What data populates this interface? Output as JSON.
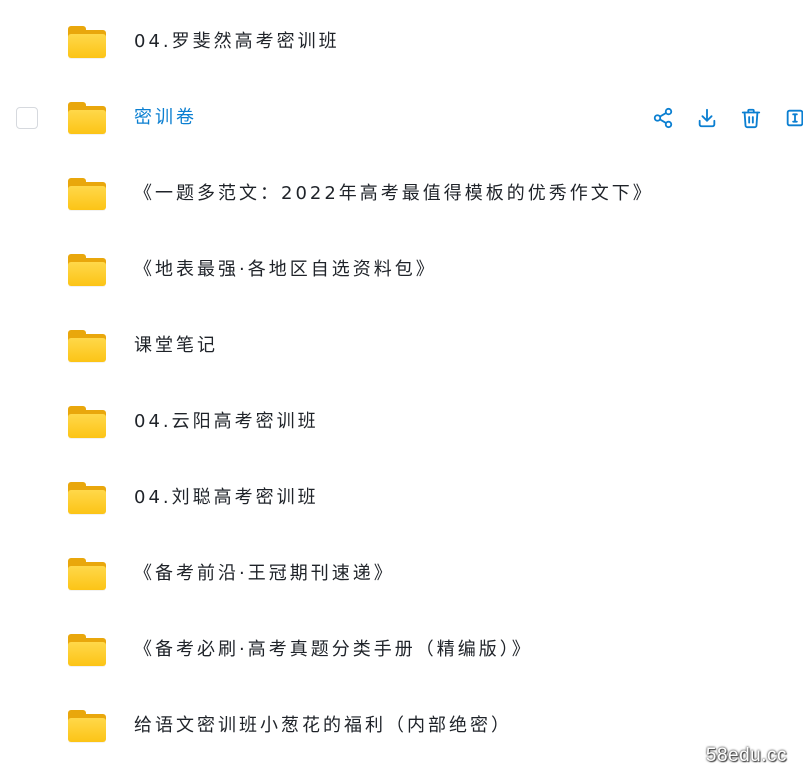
{
  "files": [
    {
      "name": "04.罗斐然高考密训班",
      "hovered": false
    },
    {
      "name": "密训卷",
      "hovered": true
    },
    {
      "name": "《一题多范文：2022年高考最值得模板的优秀作文下》",
      "hovered": false
    },
    {
      "name": "《地表最强·各地区自选资料包》",
      "hovered": false
    },
    {
      "name": "课堂笔记",
      "hovered": false
    },
    {
      "name": "04.云阳高考密训班",
      "hovered": false
    },
    {
      "name": "04.刘聪高考密训班",
      "hovered": false
    },
    {
      "name": "《备考前沿·王冠期刊速递》",
      "hovered": false
    },
    {
      "name": "《备考必刷·高考真题分类手册（精编版）》",
      "hovered": false
    },
    {
      "name": "给语文密训班小葱花的福利（内部绝密）",
      "hovered": false
    }
  ],
  "row_actions": [
    "share-icon",
    "download-icon",
    "delete-icon",
    "rename-icon"
  ],
  "colors": {
    "accent": "#0b7fd1",
    "folder": "#fcc416"
  },
  "watermark": "58edu.cc"
}
